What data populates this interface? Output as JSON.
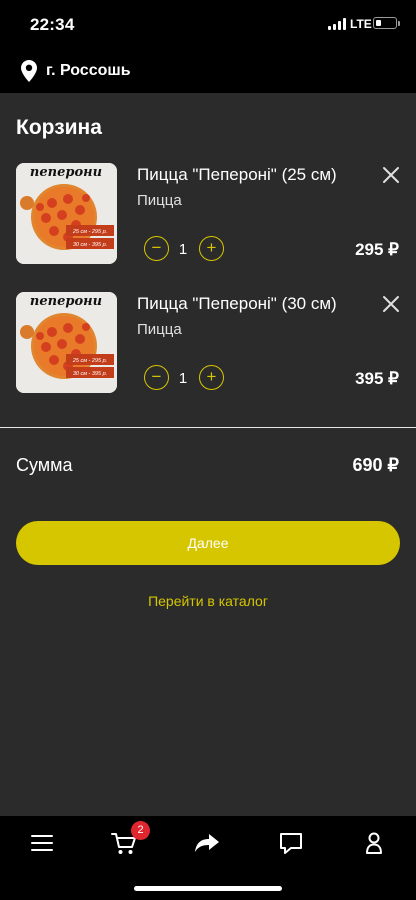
{
  "status_bar": {
    "time": "22:34",
    "network": "LTE",
    "battery_level": 0.2
  },
  "location": {
    "city": "г. Россошь",
    "icon": "location-pin-icon"
  },
  "page": {
    "title": "Корзина"
  },
  "cart": {
    "items": [
      {
        "name": "Пицца \"Пепероні\" (25 см)",
        "category": "Пицца",
        "quantity": "1",
        "price": "295 ₽",
        "image": {
          "title": "пеперони",
          "label_25": "25 см - 295 р.",
          "label_30": "30 см - 395 р."
        }
      },
      {
        "name": "Пицца \"Пепероні\" (30 см)",
        "category": "Пицца",
        "quantity": "1",
        "price": "395 ₽",
        "image": {
          "title": "пеперони",
          "label_25": "25 см - 295 р.",
          "label_30": "30 см - 395 р."
        }
      }
    ],
    "sum_label": "Сумма",
    "sum_value": "690 ₽"
  },
  "actions": {
    "next_label": "Далее",
    "catalog_label": "Перейти в каталог"
  },
  "tab_bar": {
    "tabs": [
      {
        "name": "menu",
        "icon": "hamburger-menu-icon"
      },
      {
        "name": "cart",
        "icon": "cart-icon",
        "badge": "2"
      },
      {
        "name": "share",
        "icon": "share-arrow-icon"
      },
      {
        "name": "chat",
        "icon": "chat-bubble-icon"
      },
      {
        "name": "profile",
        "icon": "profile-icon"
      }
    ]
  },
  "colors": {
    "accent": "#d6c600",
    "background": "#2b2b2b",
    "bar": "#000000",
    "badge": "#e0262e"
  }
}
